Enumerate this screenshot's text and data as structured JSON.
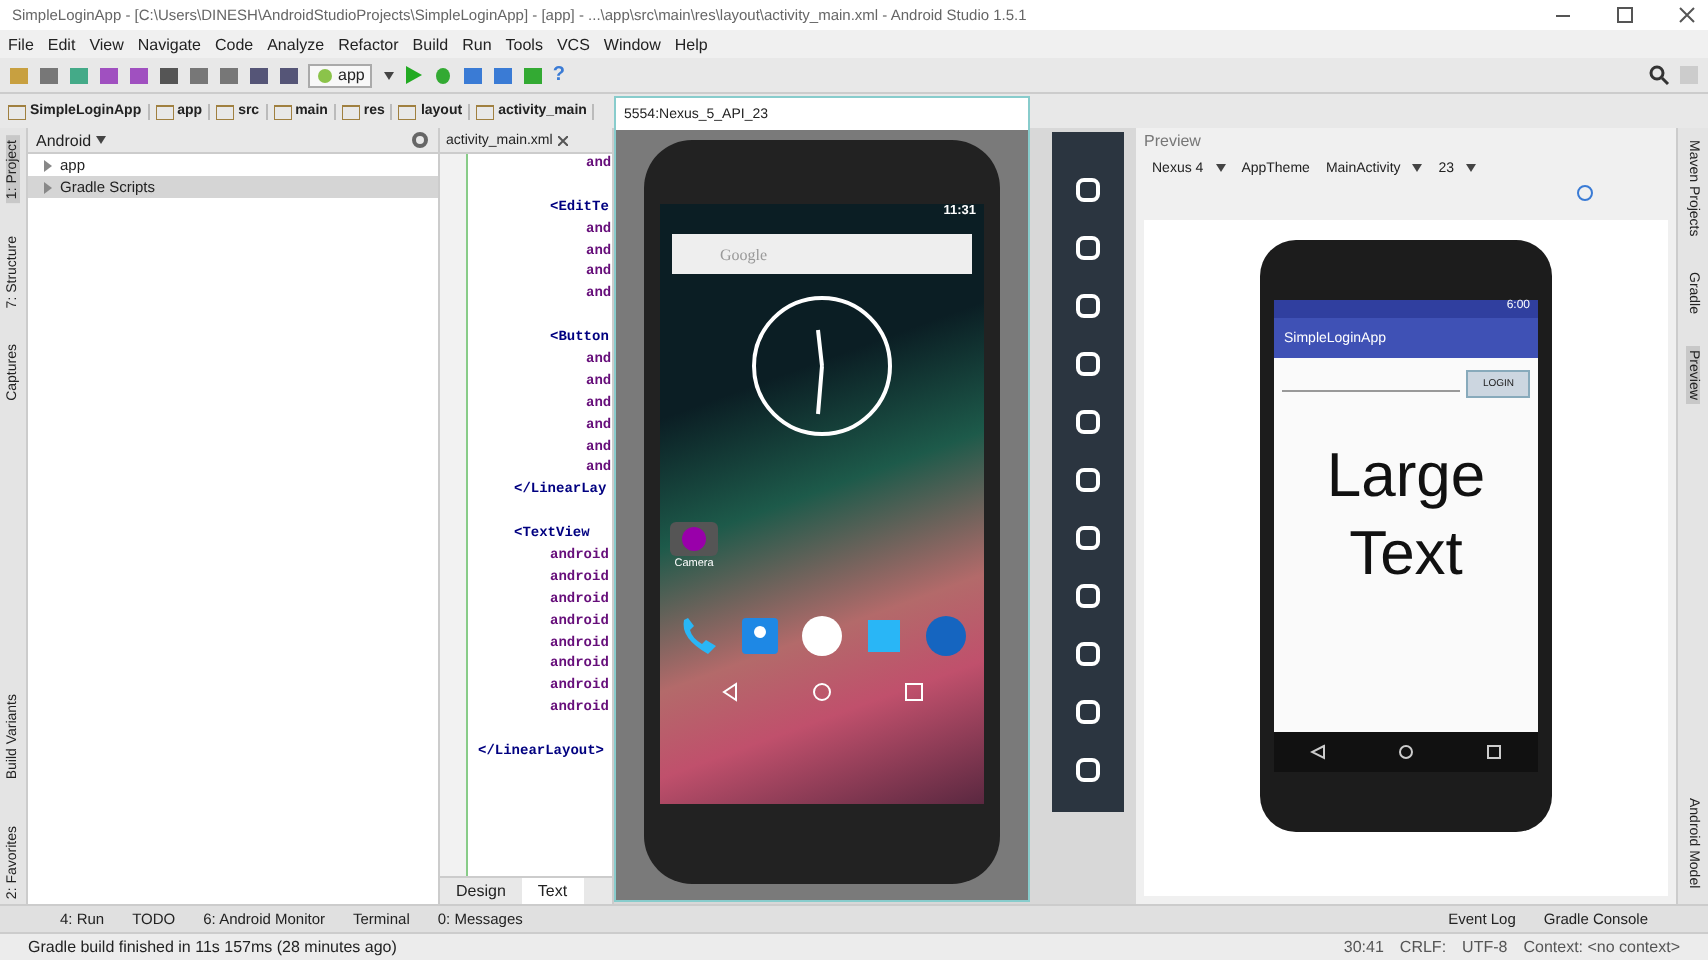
{
  "window": {
    "title": "SimpleLoginApp - [C:\\Users\\DINESH\\AndroidStudioProjects\\SimpleLoginApp] - [app] - ...\\app\\src\\main\\res\\layout\\activity_main.xml - Android Studio 1.5.1"
  },
  "menu": [
    "File",
    "Edit",
    "View",
    "Navigate",
    "Code",
    "Analyze",
    "Refactor",
    "Build",
    "Run",
    "Tools",
    "VCS",
    "Window",
    "Help"
  ],
  "toolbar": {
    "run_config": "app",
    "help": "?"
  },
  "breadcrumbs": [
    "SimpleLoginApp",
    "app",
    "src",
    "main",
    "res",
    "layout",
    "activity_main"
  ],
  "left_strip": [
    {
      "label": "1: Project",
      "selected": true
    },
    {
      "label": "7: Structure",
      "selected": false
    },
    {
      "label": "Captures",
      "selected": false
    },
    {
      "label": "Build Variants",
      "selected": false
    },
    {
      "label": "2: Favorites",
      "selected": false
    }
  ],
  "project": {
    "view": "Android",
    "tree": [
      {
        "label": "app",
        "selected": false
      },
      {
        "label": "Gradle Scripts",
        "selected": true
      }
    ]
  },
  "editor": {
    "tab": "activity_main.xml",
    "lines": [
      {
        "kind": "group",
        "children": [
          {
            "kind": "group",
            "children": [
              {
                "kind": "group",
                "children": [
                  {
                    "kind": "attr",
                    "text": "and"
                  }
                ]
              },
              {
                "kind": "blank"
              },
              {
                "kind": "tag",
                "text": "<EditTe",
                "children": [
                  {
                    "kind": "attr",
                    "text": "and"
                  },
                  {
                    "kind": "attr",
                    "text": "and"
                  },
                  {
                    "kind": "attr",
                    "text": "and"
                  },
                  {
                    "kind": "attr",
                    "text": "and"
                  }
                ]
              },
              {
                "kind": "blank"
              },
              {
                "kind": "tag",
                "text": "<Button",
                "children": [
                  {
                    "kind": "attr",
                    "text": "and"
                  },
                  {
                    "kind": "attr",
                    "text": "and"
                  },
                  {
                    "kind": "attr",
                    "text": "and"
                  },
                  {
                    "kind": "attr",
                    "text": "and"
                  },
                  {
                    "kind": "attr",
                    "text": "and"
                  },
                  {
                    "kind": "attr",
                    "text": "and"
                  }
                ]
              }
            ]
          },
          {
            "kind": "tag",
            "text": "</LinearLay"
          },
          {
            "kind": "blank"
          },
          {
            "kind": "tag",
            "text": "<TextView",
            "children": [
              {
                "kind": "attr",
                "text": "android"
              },
              {
                "kind": "attr",
                "text": "android"
              },
              {
                "kind": "attr",
                "text": "android"
              },
              {
                "kind": "attr",
                "text": "android"
              },
              {
                "kind": "attr",
                "text": "android"
              },
              {
                "kind": "attr",
                "text": "android"
              },
              {
                "kind": "attr",
                "text": "android"
              },
              {
                "kind": "attr",
                "text": "android"
              }
            ]
          },
          {
            "kind": "blank"
          }
        ]
      },
      {
        "kind": "tag",
        "text": "</LinearLayout>"
      }
    ],
    "view_tabs": [
      {
        "label": "Design",
        "selected": false
      },
      {
        "label": "Text",
        "selected": true
      }
    ]
  },
  "emulator": {
    "title": "5554:Nexus_5_API_23",
    "time": "11:31",
    "search_placeholder": "Google",
    "app_label": "Camera"
  },
  "preview": {
    "title": "Preview",
    "device": "Nexus 4",
    "theme": "AppTheme",
    "activity": "MainActivity",
    "api": "23",
    "time": "6:00",
    "app_title": "SimpleLoginApp",
    "button": "LOGIN",
    "large_text": "Large Text"
  },
  "right_strip": [
    {
      "label": "Maven Projects",
      "selected": false
    },
    {
      "label": "Gradle",
      "selected": false
    },
    {
      "label": "Preview",
      "selected": true
    },
    {
      "label": "Android Model",
      "selected": false
    }
  ],
  "tool_tabs": [
    "4: Run",
    "TODO",
    "6: Android Monitor",
    "Terminal",
    "0: Messages"
  ],
  "tool_tabs_right": [
    "Event Log",
    "Gradle Console"
  ],
  "status_bar": {
    "message": "Gradle build finished in 11s 157ms (28 minutes ago)",
    "position": "30:41",
    "line_sep": "CRLF:",
    "encoding": "UTF-8",
    "context": "Context: <no context>"
  }
}
